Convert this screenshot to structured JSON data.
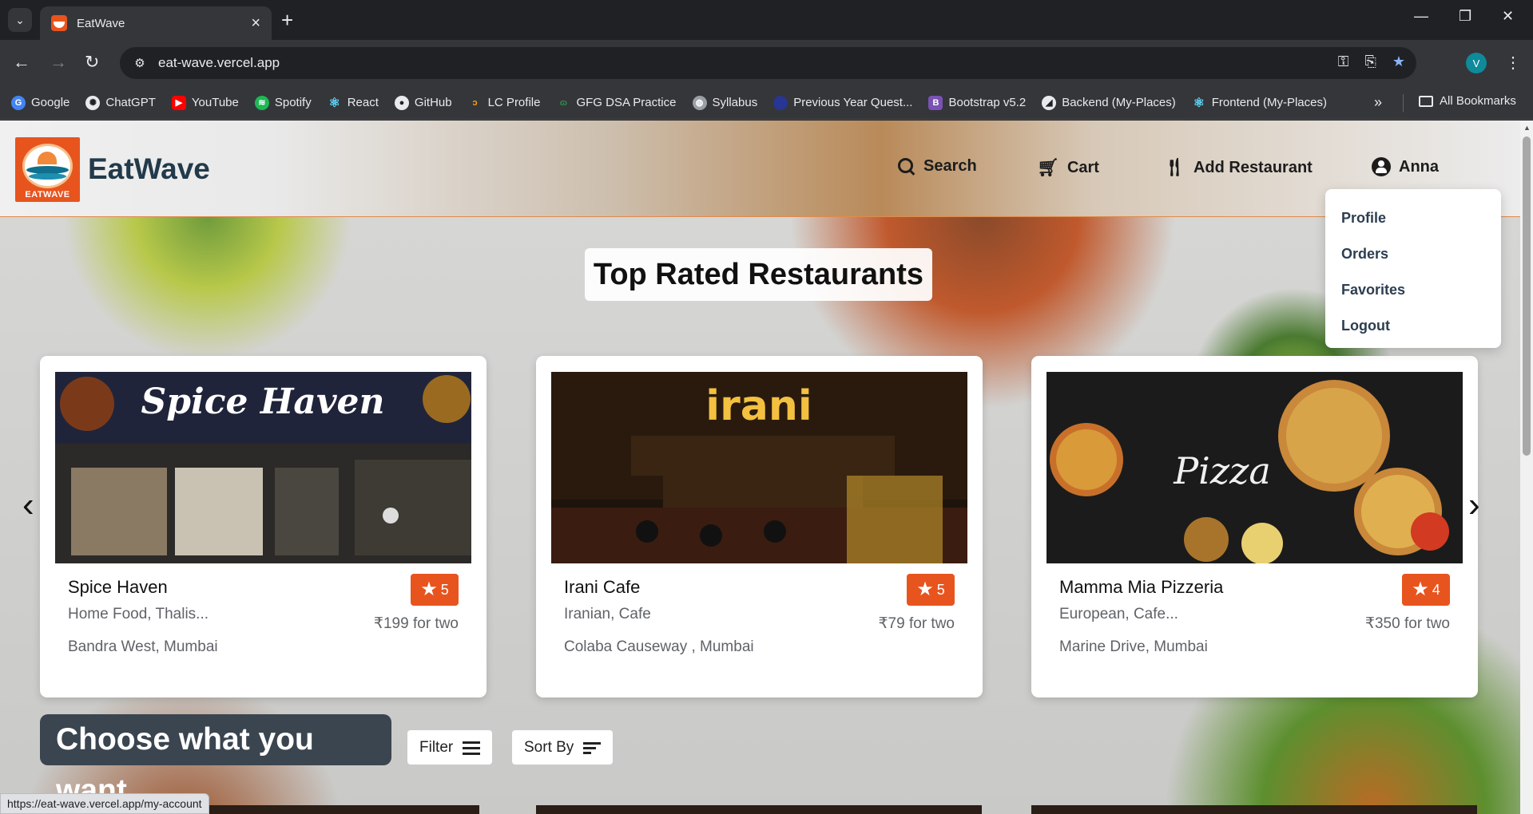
{
  "browser": {
    "tab_title": "EatWave",
    "url": "eat-wave.vercel.app",
    "profile_initial": "V",
    "bookmarks": [
      "Google",
      "ChatGPT",
      "YouTube",
      "Spotify",
      "React",
      "GitHub",
      "LC Profile",
      "GFG DSA Practice",
      "Syllabus",
      "Previous Year Quest...",
      "Bootstrap v5.2",
      "Backend (My-Places)",
      "Frontend (My-Places)"
    ],
    "all_bookmarks": "All Bookmarks",
    "status_url": "https://eat-wave.vercel.app/my-account"
  },
  "site": {
    "brand": "EatWave",
    "logo_text": "EATWAVE",
    "nav": {
      "search": "Search",
      "cart": "Cart",
      "add_restaurant": "Add Restaurant",
      "user": "Anna"
    },
    "account_menu": [
      "Profile",
      "Orders",
      "Favorites",
      "Logout"
    ],
    "section_title": "Top Rated Restaurants",
    "restaurants": [
      {
        "name": "Spice Haven",
        "cuisine": "Home Food, Thalis...",
        "price": "₹199 for two",
        "location": "Bandra West, Mumbai",
        "rating": "5",
        "sign": "Spice Haven"
      },
      {
        "name": "Irani Cafe",
        "cuisine": "Iranian, Cafe",
        "price": "₹79 for two",
        "location": "Colaba Causeway , Mumbai",
        "rating": "5",
        "sign": "irani"
      },
      {
        "name": "Mamma Mia Pizzeria",
        "cuisine": "European, Cafe...",
        "price": "₹350 for two",
        "location": "Marine Drive, Mumbai",
        "rating": "4",
        "sign": "Pizza"
      }
    ],
    "choose_title": "Choose what you want",
    "filter_label": "Filter",
    "sort_label": "Sort By"
  },
  "colors": {
    "accent": "#e8541e",
    "choose_bg": "#3a4550"
  }
}
